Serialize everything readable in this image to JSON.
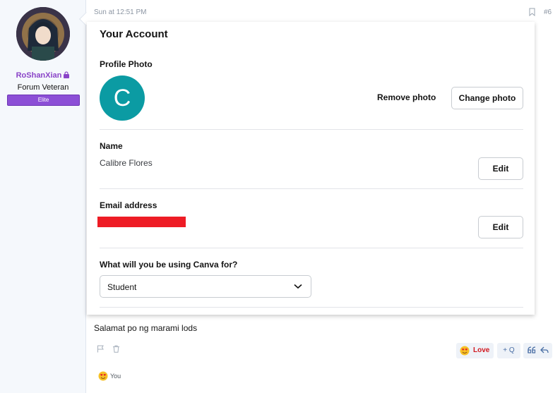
{
  "user": {
    "name": "RoShanXian",
    "title": "Forum Veteran",
    "banner": "Elite",
    "name_color": "#8a44c8"
  },
  "post": {
    "date": "Sun at 12:51 PM",
    "number": "#6",
    "message": "Salamat po ng marami lods"
  },
  "account": {
    "title": "Your Account",
    "profile_photo_label": "Profile Photo",
    "avatar_letter": "C",
    "avatar_color": "#0b9ba3",
    "remove_photo": "Remove photo",
    "change_photo": "Change photo",
    "name_label": "Name",
    "name_value": "Calibre Flores",
    "name_edit": "Edit",
    "email_label": "Email address",
    "email_edit": "Edit",
    "usage_label": "What will you be using Canva for?",
    "usage_value": "Student"
  },
  "actions": {
    "love_label": "Love",
    "quote_label": "+ Q",
    "reactions_who": "You"
  },
  "icons": [
    "lock-icon",
    "bookmark-icon",
    "chevron-down-icon",
    "flag-icon",
    "trash-icon",
    "love-emoji-icon",
    "multi-quote-icon",
    "reply-icon"
  ]
}
